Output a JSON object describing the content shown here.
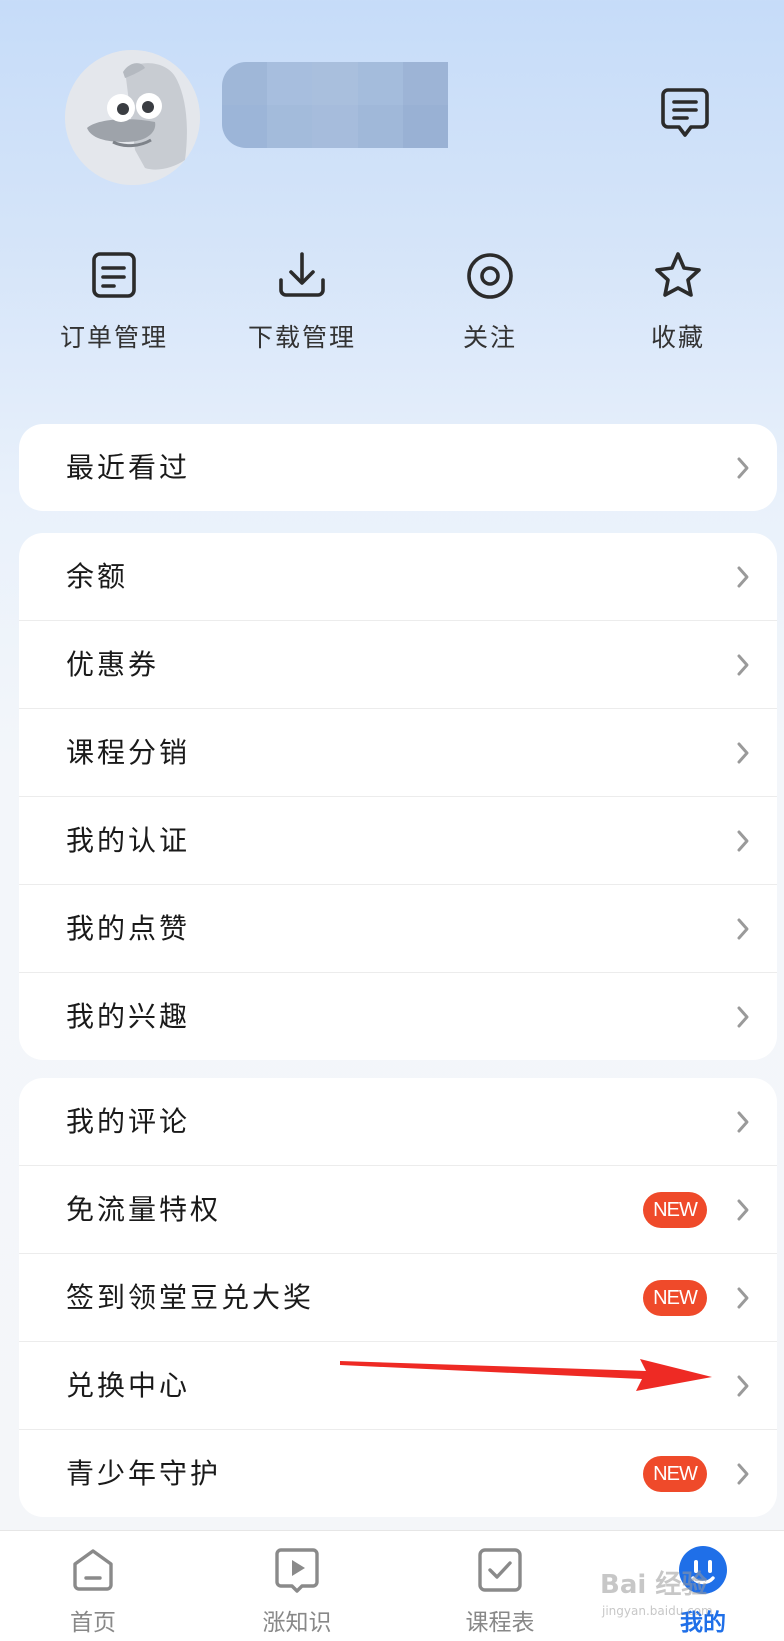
{
  "header": {
    "username": "",
    "message_icon": "message-icon"
  },
  "quick_actions": [
    {
      "label": "订单管理",
      "icon": "order-list-icon"
    },
    {
      "label": "下载管理",
      "icon": "download-icon"
    },
    {
      "label": "关注",
      "icon": "follow-eye-icon"
    },
    {
      "label": "收藏",
      "icon": "star-icon"
    }
  ],
  "recent": {
    "label": "最近看过"
  },
  "group1": [
    {
      "label": "余额"
    },
    {
      "label": "优惠券"
    },
    {
      "label": "课程分销"
    },
    {
      "label": "我的认证"
    },
    {
      "label": "我的点赞"
    },
    {
      "label": "我的兴趣"
    }
  ],
  "group2": [
    {
      "label": "我的评论",
      "badge": ""
    },
    {
      "label": "免流量特权",
      "badge": "NEW"
    },
    {
      "label": "签到领堂豆兑大奖",
      "badge": "NEW"
    },
    {
      "label": "兑换中心",
      "badge": ""
    },
    {
      "label": "青少年守护",
      "badge": "NEW"
    }
  ],
  "tabbar": [
    {
      "label": "首页",
      "icon": "home-icon",
      "active": false
    },
    {
      "label": "涨知识",
      "icon": "video-play-icon",
      "active": false
    },
    {
      "label": "课程表",
      "icon": "schedule-check-icon",
      "active": false
    },
    {
      "label": "我的",
      "icon": "profile-icon",
      "active": true
    }
  ],
  "watermark": {
    "brand": "Bai 经验",
    "url": "jingyan.baidu.com"
  },
  "colors": {
    "accent": "#1f6fe8",
    "badge": "#ef4a2a",
    "arrow": "#ee2a24"
  }
}
